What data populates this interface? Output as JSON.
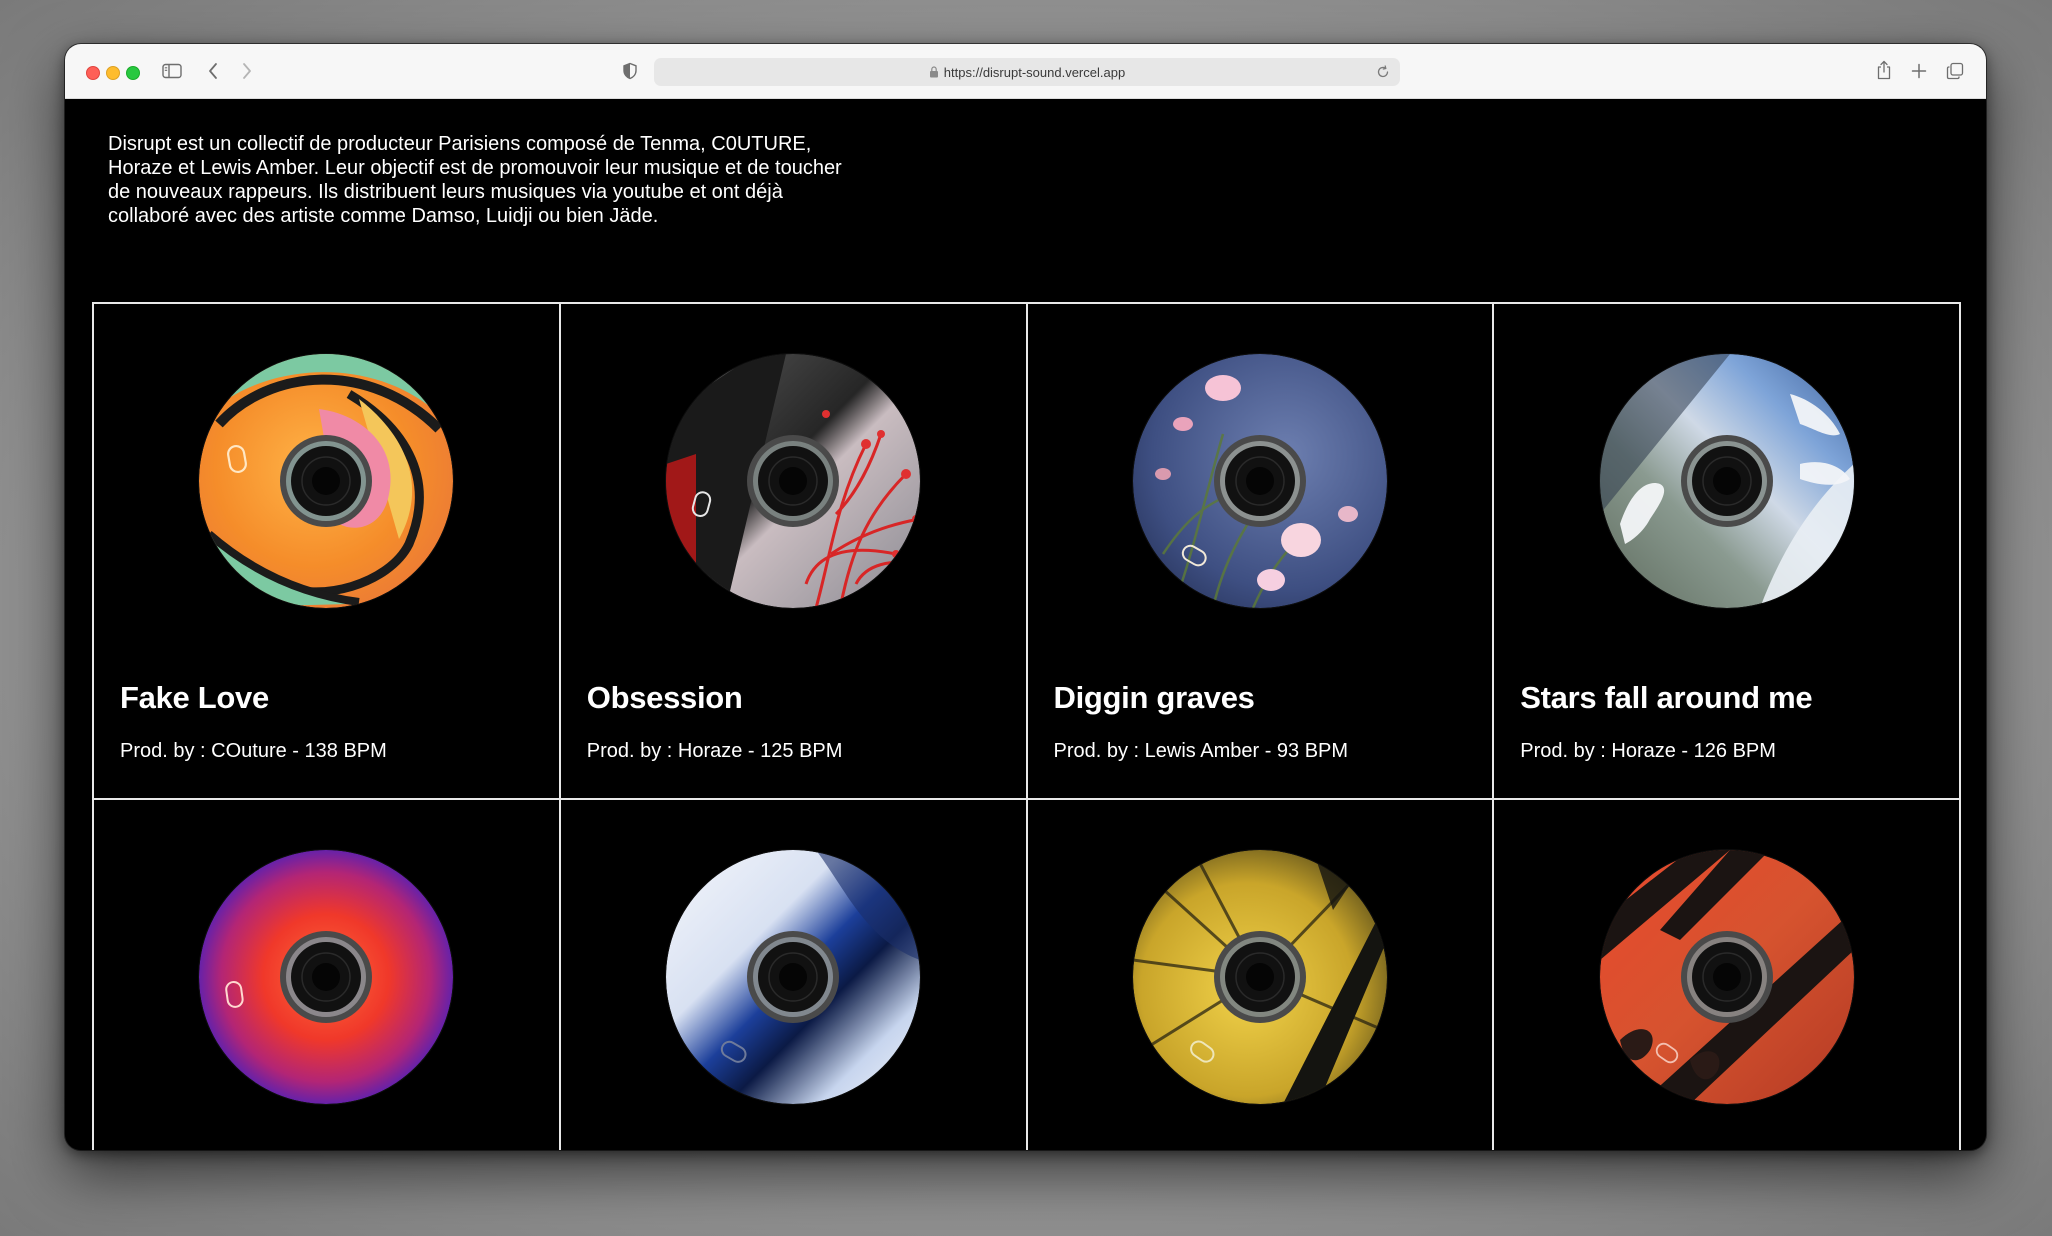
{
  "browser": {
    "url": "https://disrupt-sound.vercel.app",
    "icons": [
      "sidebar-icon",
      "back-icon",
      "forward-icon",
      "shield-icon",
      "lock-icon",
      "reload-icon",
      "share-icon",
      "plus-icon",
      "tabs-icon"
    ]
  },
  "page": {
    "intro": "Disrupt est un collectif de producteur Parisiens composé de Tenma, C0UTURE, Horaze et Lewis Amber. Leur objectif est de promouvoir leur musique et de toucher de nouveaux rappeurs. Ils distribuent leurs musiques via youtube et ont déjà collaboré avec des artiste comme Damso, Luidji ou bien Jäde.",
    "tracks": [
      {
        "title": "Fake Love",
        "meta": "Prod. by : COuture - 138 BPM"
      },
      {
        "title": "Obsession",
        "meta": "Prod. by : Horaze - 125 BPM"
      },
      {
        "title": "Diggin graves",
        "meta": "Prod. by : Lewis Amber - 93 BPM"
      },
      {
        "title": "Stars fall around me",
        "meta": "Prod. by : Horaze - 126 BPM"
      },
      {
        "title": "",
        "meta": ""
      },
      {
        "title": "",
        "meta": ""
      },
      {
        "title": "",
        "meta": ""
      },
      {
        "title": "",
        "meta": ""
      }
    ]
  },
  "colors": {
    "background": "#000000",
    "text": "#ffffff",
    "grid_line": "#e8e8e8",
    "toolbar": "#f7f7f7"
  }
}
